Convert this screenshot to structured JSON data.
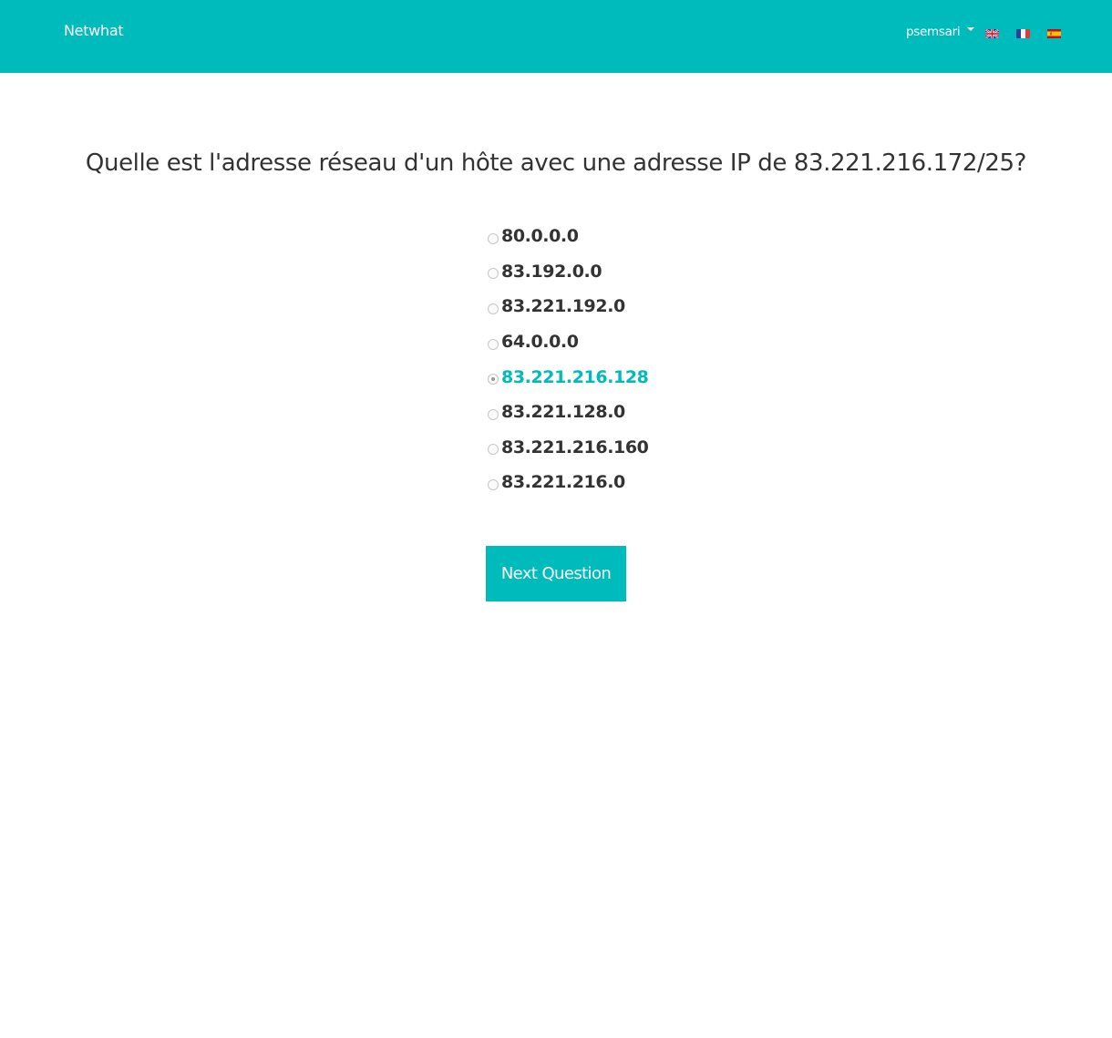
{
  "navbar": {
    "brand": "Netwhat",
    "user": "psemsari",
    "languages": [
      {
        "code": "en",
        "icon": "uk-flag-icon"
      },
      {
        "code": "fr",
        "icon": "france-flag-icon"
      },
      {
        "code": "es",
        "icon": "spain-flag-icon"
      }
    ],
    "bg_color": "#00BBBC"
  },
  "quiz": {
    "question": "Quelle est l'adresse réseau d'un hôte avec une adresse IP de 83.221.216.172/25?",
    "answers": [
      {
        "label": "80.0.0.0",
        "selected": false
      },
      {
        "label": "83.192.0.0",
        "selected": false
      },
      {
        "label": "83.221.192.0",
        "selected": false
      },
      {
        "label": "64.0.0.0",
        "selected": false
      },
      {
        "label": "83.221.216.128",
        "selected": true
      },
      {
        "label": "83.221.128.0",
        "selected": false
      },
      {
        "label": "83.221.216.160",
        "selected": false
      },
      {
        "label": "83.221.216.0",
        "selected": false
      }
    ],
    "next_label": "Next Question",
    "accent_color": "#00BBBC"
  }
}
